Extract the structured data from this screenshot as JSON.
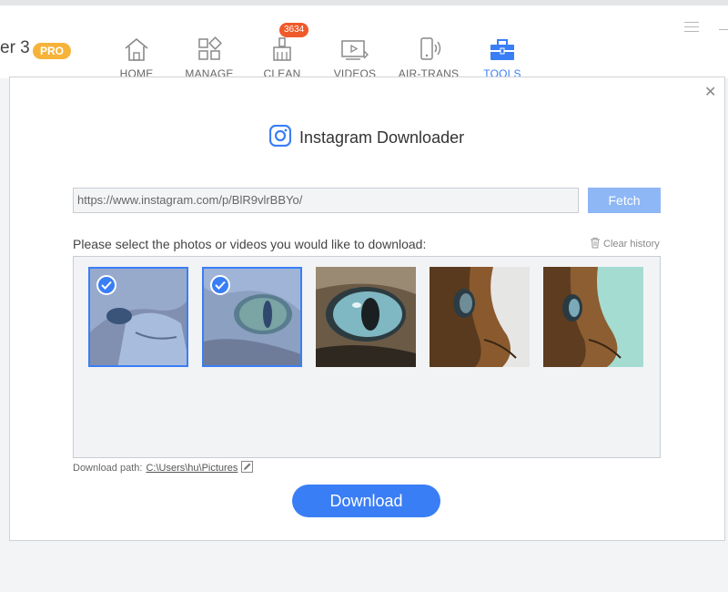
{
  "app": {
    "name_fragment": "er 3",
    "pro_badge": "PRO"
  },
  "nav": {
    "items": [
      {
        "label": "HOME",
        "icon": "home-icon"
      },
      {
        "label": "MANAGE",
        "icon": "manage-icon"
      },
      {
        "label": "CLEAN",
        "icon": "clean-icon",
        "badge": "3634"
      },
      {
        "label": "VIDEOS",
        "icon": "videos-icon"
      },
      {
        "label": "AIR-TRANS",
        "icon": "air-trans-icon"
      },
      {
        "label": "TOOLS",
        "icon": "tools-icon",
        "active": true
      }
    ]
  },
  "dialog": {
    "title": "Instagram Downloader",
    "url_value": "https://www.instagram.com/p/BlR9vlrBBYo/",
    "fetch_label": "Fetch",
    "select_prompt": "Please select the photos or videos you would like to download:",
    "clear_history_label": "Clear history",
    "download_path_label": "Download path:",
    "download_path_value": "C:\\Users\\hu\\Pictures",
    "download_label": "Download",
    "media": [
      {
        "selected": true
      },
      {
        "selected": true
      },
      {
        "selected": false
      },
      {
        "selected": false
      },
      {
        "selected": false
      }
    ]
  },
  "colors": {
    "accent": "#3a7ef6",
    "fetch_disabled": "#8eb7f6",
    "pro_badge": "#f5b33a",
    "count_badge": "#ef5a2a"
  }
}
